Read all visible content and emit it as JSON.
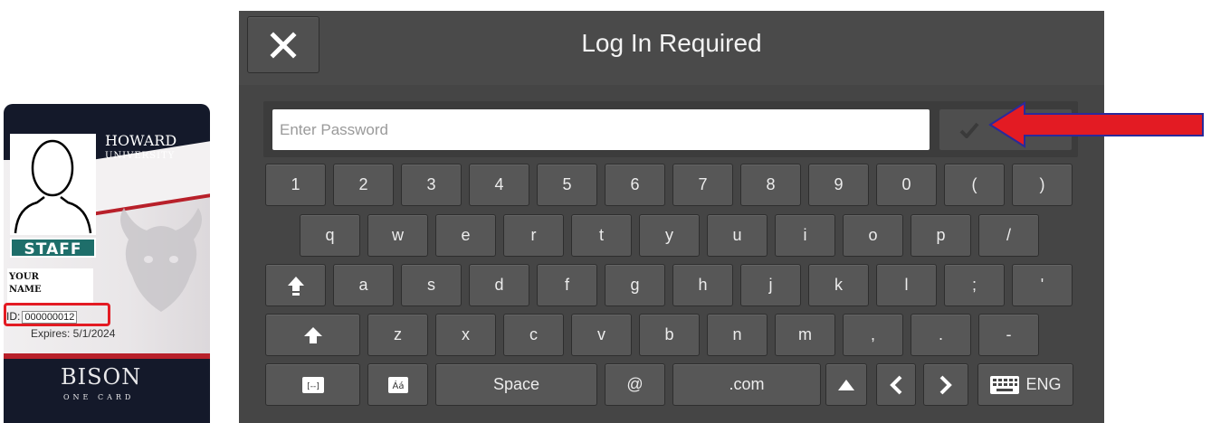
{
  "id_card": {
    "university_line1": "HOWARD",
    "university_line2": "UNIVERSITY",
    "role_badge": "STAFF",
    "name_line1": "YOUR",
    "name_line2": "NAME",
    "id_label": "ID:",
    "id_value": "000000012",
    "expires": "Expires: 5/1/2024",
    "logo_text": "BISON",
    "logo_subtext": "ONE CARD",
    "colors": {
      "navy": "#14192a",
      "red": "#b8202a",
      "teal": "#1e6e6a",
      "highlight": "#e31b23"
    }
  },
  "dialog": {
    "title": "Log In Required",
    "close_icon": "close-icon",
    "password_placeholder": "Enter Password",
    "ok_label": "OK",
    "ok_icon": "checkmark-icon"
  },
  "keyboard": {
    "row1": [
      "1",
      "2",
      "3",
      "4",
      "5",
      "6",
      "7",
      "8",
      "9",
      "0",
      "(",
      ")"
    ],
    "row2": [
      "q",
      "w",
      "e",
      "r",
      "t",
      "y",
      "u",
      "i",
      "o",
      "p",
      "/"
    ],
    "row3": [
      "a",
      "s",
      "d",
      "f",
      "g",
      "h",
      "j",
      "k",
      "l",
      ";",
      "'"
    ],
    "row3_caps_icon": "caps-lock-icon",
    "row4": [
      "z",
      "x",
      "c",
      "v",
      "b",
      "n",
      "m",
      ",",
      ".",
      "-"
    ],
    "row4_shift_icon": "shift-icon",
    "row5": {
      "hide_icon": "keyboard-hide-icon",
      "hide_label": "[--]",
      "accent_icon": "accent-chars-icon",
      "accent_label": "Áá",
      "space": "Space",
      "at": "@",
      "dotcom": ".com",
      "up_icon": "caret-up-icon",
      "left_icon": "chevron-left-icon",
      "right_icon": "chevron-right-icon",
      "language": "ENG",
      "language_icon": "keyboard-icon"
    }
  },
  "annotation": {
    "arrow_color": "#e31b23",
    "arrow_icon": "left-arrow-icon"
  }
}
